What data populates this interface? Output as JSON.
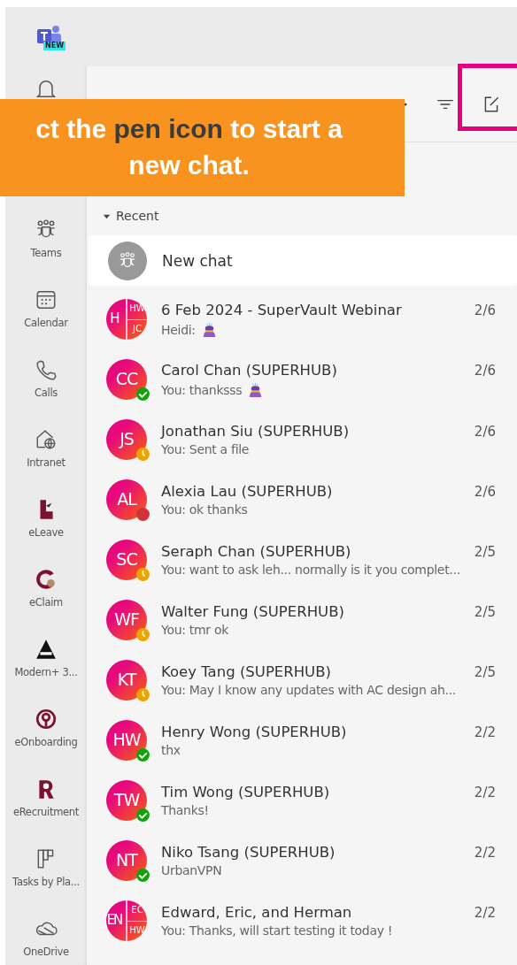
{
  "app": {
    "logo_badge": "NEW"
  },
  "rail": {
    "items": [
      {
        "label": "Teams",
        "selected": false
      },
      {
        "label": "Calendar",
        "selected": false
      },
      {
        "label": "Calls",
        "selected": false
      },
      {
        "label": "Intranet",
        "selected": false
      },
      {
        "label": "eLeave",
        "selected": false
      },
      {
        "label": "eClaim",
        "selected": false
      },
      {
        "label": "Modern+ 3...",
        "selected": false
      },
      {
        "label": "eOnboarding",
        "selected": false
      },
      {
        "label": "eRecruitment",
        "selected": false
      },
      {
        "label": "Tasks by Pla...",
        "selected": false
      },
      {
        "label": "OneDrive",
        "selected": false
      }
    ]
  },
  "callout": {
    "text": "ct the **pen icon** to start a new chat."
  },
  "chat_list": {
    "section": "Recent",
    "expanded": true,
    "new_chat": "New chat",
    "chats": [
      {
        "kind": "group",
        "initials": [
          "H",
          "HW",
          "JC"
        ],
        "name": "6 Feb 2024 - SuperVault Webinar",
        "preview": "Heidi:",
        "emoji": true,
        "date": "2/6"
      },
      {
        "kind": "person",
        "initials": "CC",
        "name": "Carol Chan (SUPERHUB)",
        "preview": "You: thanksss",
        "emoji": true,
        "date": "2/6",
        "color": "#13a10e"
      },
      {
        "kind": "person",
        "initials": "JS",
        "name": "Jonathan Siu (SUPERHUB)",
        "preview": "You: Sent a file",
        "emoji": false,
        "date": "2/6",
        "color": "#eaa300"
      },
      {
        "kind": "person",
        "initials": "AL",
        "name": "Alexia Lau (SUPERHUB)",
        "preview": "You: ok thanks",
        "emoji": false,
        "date": "2/6",
        "color": "#d13438"
      },
      {
        "kind": "person",
        "initials": "SC",
        "name": "Seraph Chan (SUPERHUB)",
        "preview": "You: want to ask leh... normally is it you complet...",
        "emoji": false,
        "date": "2/5",
        "color": "#eaa300"
      },
      {
        "kind": "person",
        "initials": "WF",
        "name": "Walter Fung (SUPERHUB)",
        "preview": "You: tmr ok",
        "emoji": false,
        "date": "2/5",
        "color": "#eaa300"
      },
      {
        "kind": "person",
        "initials": "KT",
        "name": "Koey Tang (SUPERHUB)",
        "preview": "You: May I know any updates with AC design ah...",
        "emoji": false,
        "date": "2/5",
        "color": "#eaa300"
      },
      {
        "kind": "person",
        "initials": "HW",
        "name": "Henry Wong (SUPERHUB)",
        "preview": "thx",
        "emoji": false,
        "date": "2/2",
        "color": "#13a10e"
      },
      {
        "kind": "person",
        "initials": "TW",
        "name": "Tim Wong (SUPERHUB)",
        "preview": "Thanks!",
        "emoji": false,
        "date": "2/2",
        "color": "#13a10e"
      },
      {
        "kind": "person",
        "initials": "NT",
        "name": "Niko Tsang (SUPERHUB)",
        "preview": "UrbanVPN",
        "emoji": false,
        "date": "2/2",
        "color": "#13a10e"
      },
      {
        "kind": "group",
        "initials": [
          "EN",
          "EC",
          "HW"
        ],
        "name": "Edward, Eric, and Herman",
        "preview": "You: Thanks, will start testing it today !",
        "emoji": false,
        "date": "2/2"
      }
    ]
  }
}
